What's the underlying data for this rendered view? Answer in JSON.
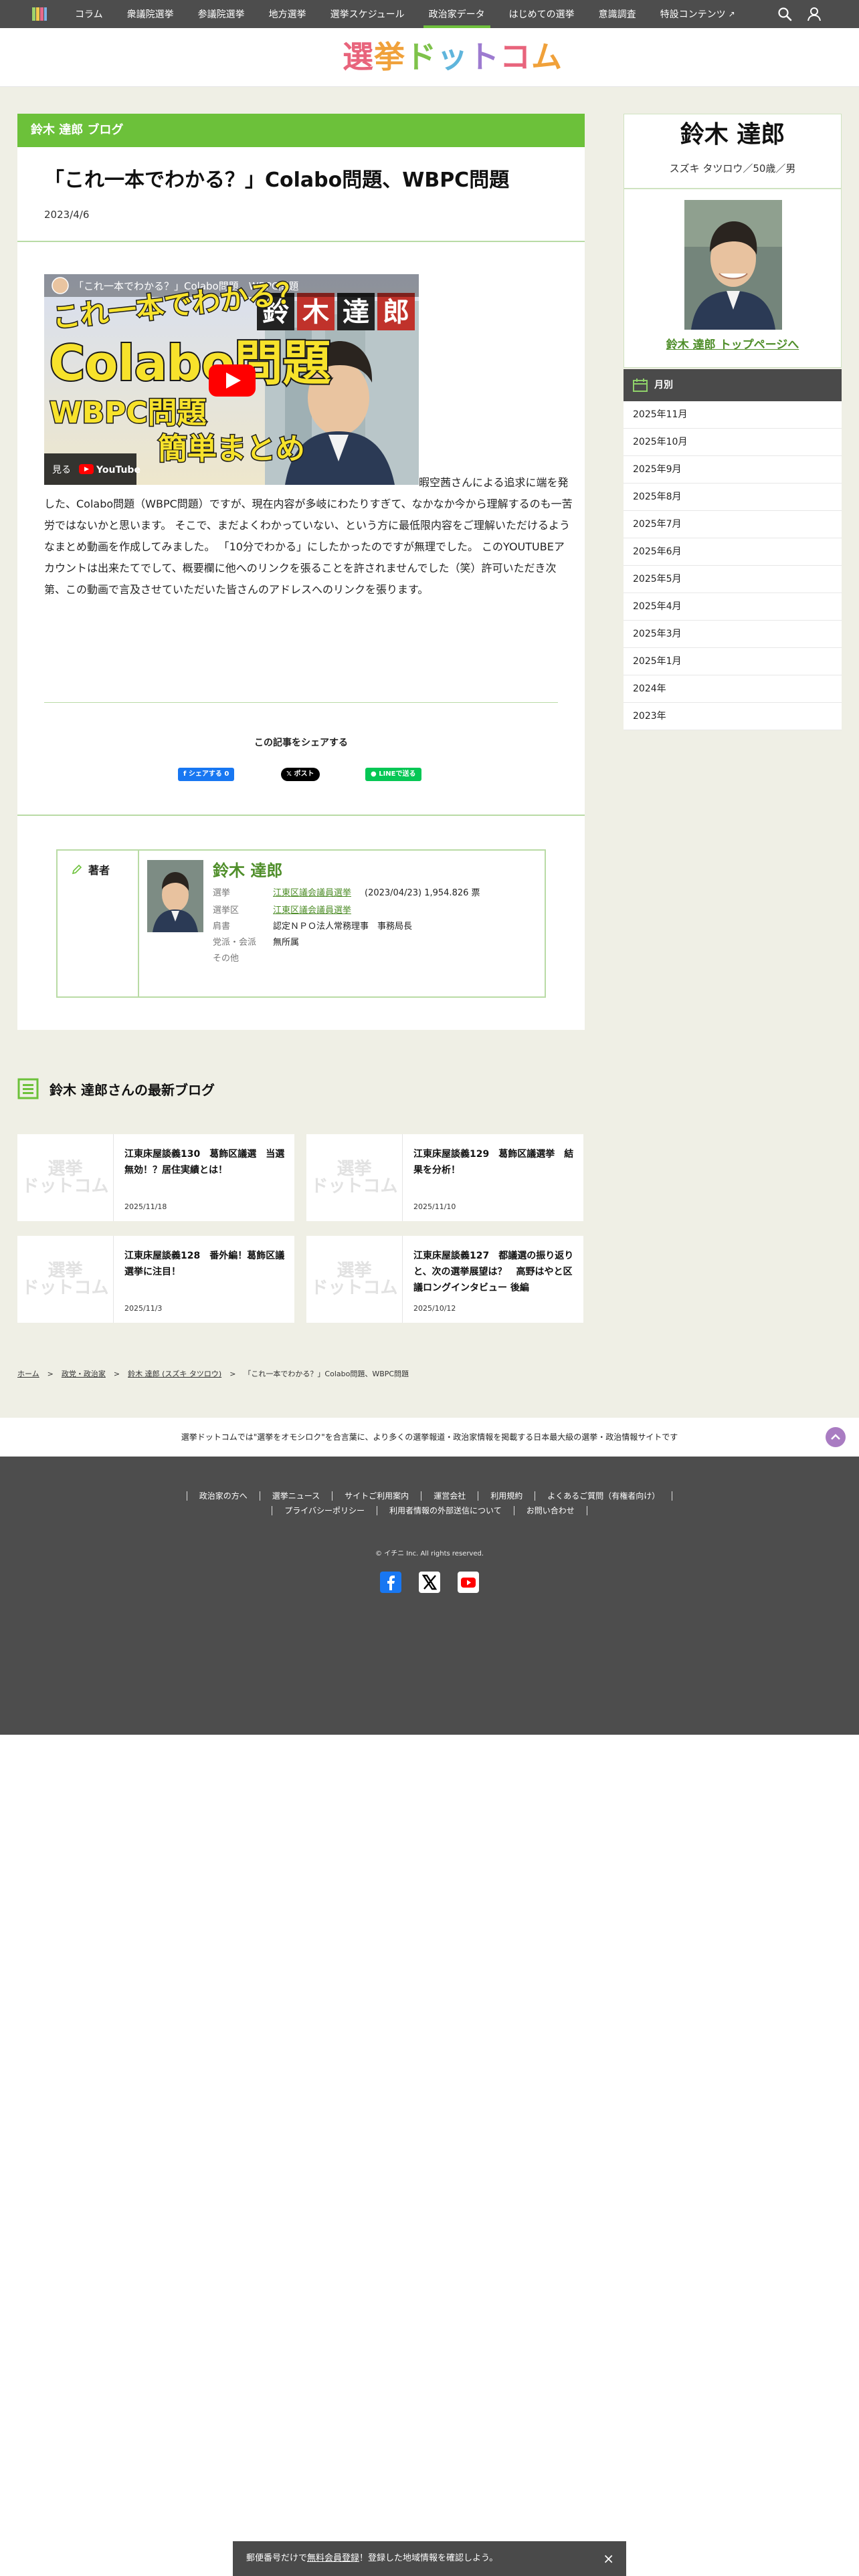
{
  "nav": {
    "items": [
      "コラム",
      "衆議院選挙",
      "参議院選挙",
      "地方選挙",
      "選挙スケジュール",
      "政治家データ",
      "はじめての選挙",
      "意識調査",
      "特設コンテンツ"
    ],
    "active": "政治家データ"
  },
  "site": {
    "logo": [
      "選",
      "挙",
      "ド",
      "ッ",
      "ト",
      "コ",
      "ム"
    ]
  },
  "blog": {
    "header": "鈴木 達郎 ブログ",
    "title": "「これ一本でわかる？」Colabo問題、WBPC問題",
    "date": "2023/4/6",
    "body_lead": "暇空茜さんによる追求に",
    "body_rest": "端を発した、Colabo問題（WBPC問題）ですが、現在内容が多岐にわたりすぎて、なかなか今から理解するのも一苦労ではないかと思います。 そこで、まだよくわかっていない、という方に最低限内容をご理解いただけるようなまとめ動画を作成してみました。 「10分でわかる」にしたかったのですが無理でした。 このYOUTUBEアカウントは出来たてでして、概要欄に他へのリンクを張ることを許されませんでした（笑）許可いただき次第、この動画で言及させていただいた皆さんのアドレスへのリンクを張ります。"
  },
  "video": {
    "top_caption": "「これ一本でわかる？」Colabo問題、WBPC問題",
    "line1": "これ一本でわかる？",
    "line2": "Colabo問題",
    "line3": "WBPC問題",
    "line4": "簡単まとめ",
    "name_tiles": [
      "鈴",
      "木",
      "達",
      "郎"
    ],
    "watch_label": "見る",
    "youtube_label": "YouTube"
  },
  "share": {
    "title": "この記事をシェアする",
    "facebook": "シェアする 0",
    "x": "ポスト",
    "line": "LINEで送る"
  },
  "author": {
    "label": "著者",
    "name": "鈴木 達郎",
    "rows": [
      {
        "key": "選挙",
        "value": "江東区議会議員選挙",
        "extra": "(2023/04/23) 1,954.826 票"
      },
      {
        "key": "選挙区",
        "value": "江東区議会議員選挙",
        "extra": ""
      },
      {
        "key": "肩書",
        "value": "認定ＮＰＯ法人常務理事　事務局長",
        "extra": ""
      },
      {
        "key": "党派・会派",
        "value": "無所属",
        "extra": ""
      },
      {
        "key": "その他",
        "value": "",
        "extra": ""
      }
    ]
  },
  "sidebar": {
    "name": "鈴木 達郎",
    "kana": "スズキ タツロウ／50歳／男",
    "top_link": "鈴木 達郎 トップページへ",
    "monthly_title": "月別",
    "months": [
      "2025年11月",
      "2025年10月",
      "2025年9月",
      "2025年8月",
      "2025年7月",
      "2025年6月",
      "2025年5月",
      "2025年4月",
      "2025年3月",
      "2025年1月",
      "2024年",
      "2023年"
    ]
  },
  "latest": {
    "title": "鈴木 達郎さんの最新ブログ",
    "thumb_text": "選挙\nドットコム",
    "cards": [
      {
        "title": "江東床屋談義130　葛飾区議選　当選無効！？居住実績とは！",
        "date": "2025/11/18"
      },
      {
        "title": "江東床屋談義129　葛飾区議選挙　結果を分析！",
        "date": "2025/11/10"
      },
      {
        "title": "江東床屋談義128　番外編！葛飾区議選挙に注目！",
        "date": "2025/11/3"
      },
      {
        "title": "江東床屋談義127　都議選の振り返りと、次の選挙展望は？　高野はやと区議ロングインタビュー 後編",
        "date": "2025/10/12"
      }
    ]
  },
  "breadcrumb": [
    "ホーム",
    "政党・政治家",
    "鈴木 達郎 (スズキ タツロウ)",
    "「これ一本でわかる？」Colabo問題、WBPC問題"
  ],
  "tagline": "選挙ドットコムでは\"選挙をオモシロク\"を合言葉に、より多くの選挙報道・政治家情報を掲載する日本最大級の選挙・政治情報サイトです",
  "footer": {
    "row1": [
      "政治家の方へ",
      "選挙ニュース",
      "サイトご利用案内",
      "運営会社",
      "利用規約",
      "よくあるご質問（有権者向け）"
    ],
    "row2": [
      "プライバシーポリシー",
      "利用者情報の外部送信について",
      "お問い合わせ"
    ],
    "copyright": "© イチニ Inc. All rights reserved."
  },
  "banner": {
    "pre": "郵便番号だけで",
    "link": "無料会員登録",
    "post": "！登録した地域情報を確認しよう。",
    "close": "×"
  },
  "colors": {
    "accent": "#6cc13a",
    "nav": "#4d4d4d",
    "link": "#4f8e2a"
  }
}
